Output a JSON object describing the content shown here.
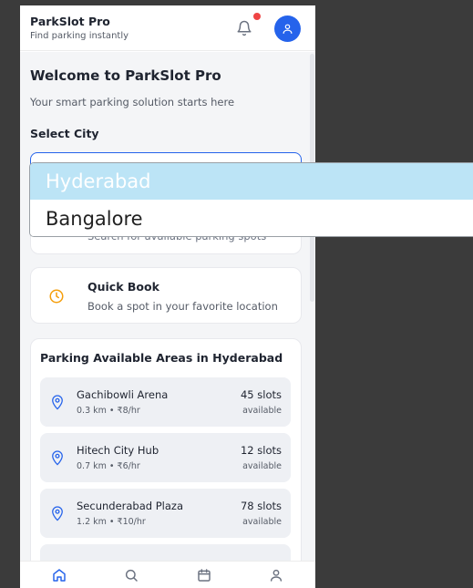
{
  "header": {
    "title": "ParkSlot Pro",
    "subtitle": "Find parking instantly"
  },
  "welcome": {
    "title": "Welcome to ParkSlot Pro",
    "subtitle": "Your smart parking solution starts here"
  },
  "city": {
    "label": "Select City",
    "options": [
      "Hyderabad",
      "Bangalore"
    ],
    "highlighted_option": "Hyderabad"
  },
  "search_card": {
    "description": "Search for available parking spots"
  },
  "quick_book": {
    "title": "Quick Book",
    "description": "Book a spot in your favorite location"
  },
  "areas": {
    "title": "Parking Available Areas in Hyderabad",
    "items": [
      {
        "name": "Gachibowli Arena",
        "meta": "0.3 km • ₹8/hr",
        "slots": "45 slots",
        "status": "available"
      },
      {
        "name": "Hitech City Hub",
        "meta": "0.7 km • ₹6/hr",
        "slots": "12 slots",
        "status": "available"
      },
      {
        "name": "Secunderabad Plaza",
        "meta": "1.2 km • ₹10/hr",
        "slots": "78 slots",
        "status": "available"
      }
    ]
  },
  "colors": {
    "accent": "#2563eb",
    "notification_dot": "#ef4444",
    "quick_book_icon": "#f59e0b",
    "highlight": "#bce4f6"
  },
  "icons": {
    "notifications": "bell-icon",
    "profile": "user-icon",
    "quick_book": "clock-icon",
    "area": "map-pin-icon",
    "nav": [
      "home-icon",
      "search-icon",
      "calendar-icon",
      "user-icon"
    ]
  }
}
